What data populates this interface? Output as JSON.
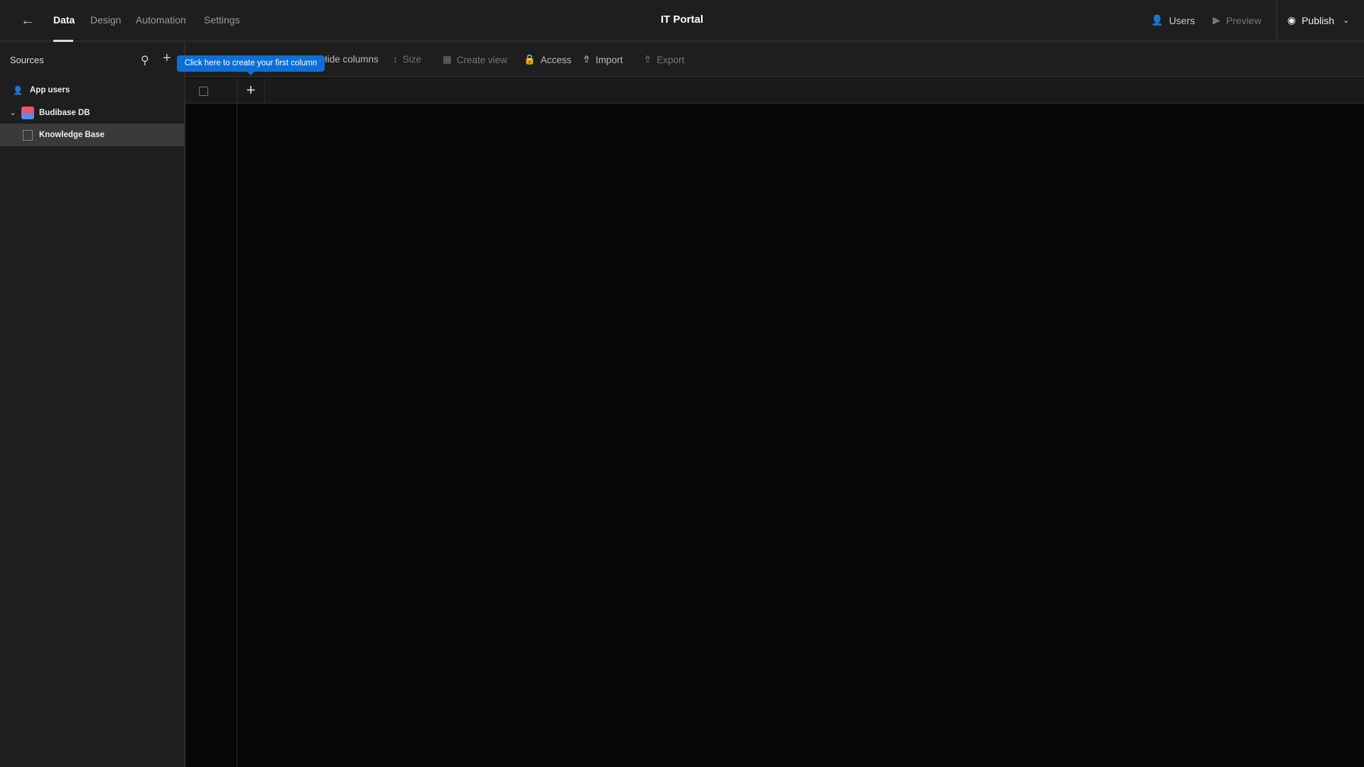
{
  "header": {
    "title": "IT Portal",
    "tabs": [
      {
        "label": "Data"
      },
      {
        "label": "Design"
      },
      {
        "label": "Automation"
      },
      {
        "label": "Settings"
      }
    ],
    "users_label": "Users",
    "preview_label": "Preview",
    "publish_label": "Publish"
  },
  "sidebar": {
    "title": "Sources",
    "items": [
      {
        "label": "App users"
      },
      {
        "label": "Budibase DB"
      },
      {
        "label": "Knowledge Base"
      }
    ]
  },
  "toolbar": {
    "hide_columns": "Hide columns",
    "size": "Size",
    "create_view": "Create view",
    "access": "Access",
    "import": "Import",
    "export": "Export"
  },
  "tooltip": {
    "text": "Click here to create your first column"
  },
  "colors": {
    "accent": "#0d6fd6",
    "background": "#070707",
    "panel": "#1e1e1e"
  }
}
